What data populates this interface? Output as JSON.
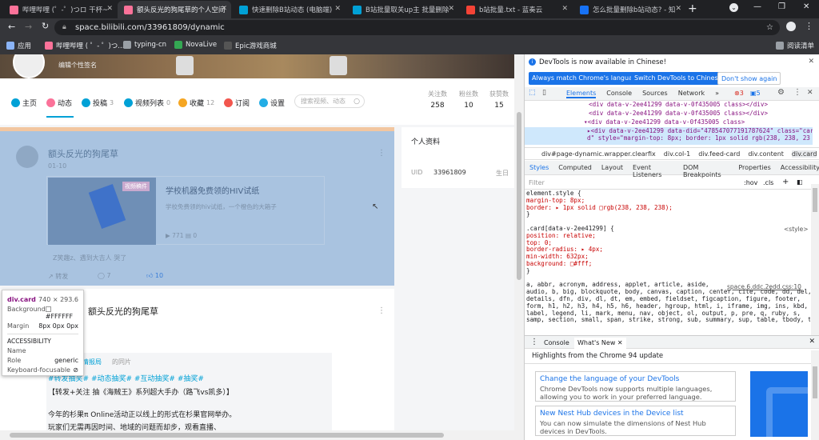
{
  "tabs": [
    {
      "title": "哔哩哔哩 (゜-゜)つロ 干杯~",
      "favicon_color": "#fb7299",
      "active": false
    },
    {
      "title": "额头反光的狗尾草的个人空间",
      "favicon_color": "#fb7299",
      "active": true
    },
    {
      "title": "快速删除B站动态 (电脑端)",
      "favicon_color": "#00a1d6",
      "active": false
    },
    {
      "title": "B站批量取关up主 批量删除",
      "favicon_color": "#00a1d6",
      "active": false
    },
    {
      "title": "b站批量.txt - 蓝奏云",
      "favicon_color": "#f44336",
      "active": false
    },
    {
      "title": "怎么批量删除b站动态? - 知",
      "favicon_color": "#1772f6",
      "active": false
    }
  ],
  "new_tab": "+",
  "window_controls": [
    "⌄",
    "—",
    "❐",
    "✕"
  ],
  "url": "space.bilibili.com/33961809/dynamic",
  "bookmarks": [
    {
      "label": "应用",
      "color": "#8ab4f8"
    },
    {
      "label": "哔哩哔哩 ( ゜- ゜)つ...",
      "color": "#fb7299"
    },
    {
      "label": "typing-cn",
      "color": "#9aa0a6"
    },
    {
      "label": "NovaLive",
      "color": "#34a853"
    },
    {
      "label": "Epic游戏商城",
      "color": "#444"
    }
  ],
  "reading_list": "阅读清单",
  "site": {
    "signature": "编辑个性签名",
    "nav": [
      {
        "label": "主页",
        "count": "",
        "color": "#00a1d6"
      },
      {
        "label": "动态",
        "count": "",
        "color": "#fb7299"
      },
      {
        "label": "投稿",
        "count": "3",
        "color": "#00a1d6"
      },
      {
        "label": "视频列表",
        "count": "0",
        "color": "#00a1d6"
      },
      {
        "label": "收藏",
        "count": "12",
        "color": "#f5a623"
      },
      {
        "label": "订阅",
        "count": "",
        "color": "#f2564e"
      },
      {
        "label": "设置",
        "count": "",
        "color": "#23ade5"
      }
    ],
    "search_placeholder": "搜索视频、动态",
    "stats": [
      {
        "label": "关注数",
        "value": "258"
      },
      {
        "label": "粉丝数",
        "value": "10"
      },
      {
        "label": "获赞数",
        "value": "15"
      }
    ],
    "card1": {
      "author": "额头反光的狗尾草",
      "time": "01-10",
      "video_badge": "视频稿件",
      "video_title": "学校机器免费领的HIV试纸",
      "video_desc": "学校免费领的hiv试纸，一个橙色的大箱子",
      "video_views": "771",
      "video_danmaku": "0",
      "comment": "Z笑趣z、遇到大吉人 哭了",
      "forward": "转发",
      "comments_count": "7",
      "likes": "10"
    },
    "card2": {
      "author": "额头反光的狗尾草",
      "source": "的同片",
      "source_user": "情报局",
      "tags": "#转发抽奖# #动态抽奖# #互动抽奖# #抽奖#",
      "line1": "【转发+关注 抽《海贼王》系列超大手办（路飞vs凯多）】",
      "line2": "今年的杉果π Online活动正以线上的形式在杉果官网举办。",
      "line3": "玩家们无需再因时间、地域的问题而却步，观看直播、"
    },
    "profile": {
      "title": "个人资料",
      "uid_label": "UID",
      "uid": "33961809",
      "birthday": "生日"
    }
  },
  "tooltip": {
    "name": "div.card",
    "size": "740 × 293.6",
    "background_label": "Background",
    "background": "#FFFFFF",
    "margin_label": "Margin",
    "margin": "8px 0px 0px",
    "accessibility": "ACCESSIBILITY",
    "a11y_name": "Name",
    "a11y_role": "Role",
    "a11y_role_val": "generic",
    "a11y_kb": "Keyboard-focusable"
  },
  "devtools": {
    "notice": "DevTools is now available in Chinese!",
    "btn_match": "Always match Chrome's language",
    "btn_switch": "Switch DevTools to Chinese",
    "btn_dont": "Don't show again",
    "main_tabs": [
      "Elements",
      "Console",
      "Sources",
      "Network",
      "»"
    ],
    "errors": "3",
    "warnings": "5",
    "dom_lines": [
      "<div data-v-2ee41299 data-v-0f435005 class></div>",
      "<div data-v-2ee41299 data-v-0f435005 class></div>",
      "▾<div data-v-2ee41299 data-v-0f435005 class>",
      "  ▸<div data-v-2ee41299 data-did=\"478547077191787624\" class=\"car",
      "   d\" style=\"margin-top: 8px; border: 1px solid rgb(238, 238, 23"
    ],
    "breadcrumbs": [
      "div#page-dynamic.wrapper.clearfix",
      "div.col-1",
      "div.feed-card",
      "div.content",
      "div.card"
    ],
    "style_tabs": [
      "Styles",
      "Computed",
      "Layout",
      "Event Listeners",
      "DOM Breakpoints",
      "Properties",
      "Accessibility"
    ],
    "filter_placeholder": "Filter",
    "hov": ":hov",
    "cls": ".cls",
    "css_lines": [
      "element.style {",
      "  margin-top: 8px;",
      "  border: ▸ 1px solid □rgb(238, 238, 238);",
      "}",
      "",
      ".card[data-v-2ee41299] {",
      "  position: relative;",
      "  top: 0;",
      "  border-radius: ▸ 4px;",
      "  min-width: 632px;",
      "  background: □#fff;",
      "}",
      "",
      "a, abbr, acronym, address, applet, article, aside,",
      "audio, b, big, blockquote, body, canvas, caption, center, cite, code, dd, del,",
      "details, dfn, div, dl, dt, em, embed, fieldset, figcaption, figure, footer,",
      "form, h1, h2, h3, h4, h5, h6, header, hgroup, html, i, iframe, img, ins, kbd,",
      "label, legend, li, mark, menu, nav, object, ol, output, p, pre, q, ruby, s,",
      "samp, section, small, span, strike, strong, sub, summary, sup, table, tbody, td,"
    ],
    "style_src": "<style>",
    "css_src": "space.6.ddc.2edd.css:10",
    "drawer_tabs": [
      "Console",
      "What's New"
    ],
    "highlights": "Highlights from the Chrome 94 update",
    "news": [
      {
        "title": "Change the language of your DevTools",
        "desc": "Chrome DevTools now supports multiple languages, allowing you to work in your preferred language."
      },
      {
        "title": "New Nest Hub devices in the Device list",
        "desc": "You can now simulate the dimensions of Nest Hub devices in DevTools."
      }
    ]
  },
  "colors": {
    "bili_blue": "#00a1d6",
    "bili_pink": "#fb7299",
    "highlight": "#a9c3e0",
    "devtools_blue": "#1a73e8"
  }
}
